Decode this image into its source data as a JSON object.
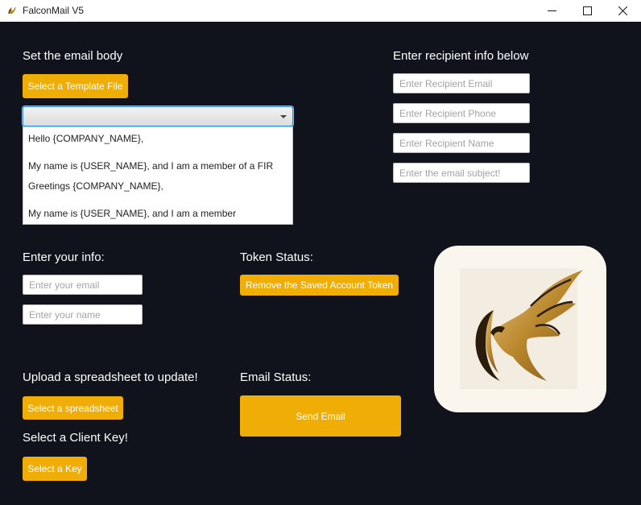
{
  "window": {
    "title": "FalconMail V5",
    "controls": {
      "minimize": "─",
      "maximize": "☐",
      "close": "✕"
    }
  },
  "email_body": {
    "heading": "Set the email body",
    "template_button": "Select a Template File",
    "template_combo_value": "",
    "options": [
      "Hello {COMPANY_NAME},",
      "My name is {USER_NAME}, and I am a member of a FIR",
      "Greetings {COMPANY_NAME},",
      "My name is {USER_NAME}, and I am a member"
    ]
  },
  "recipient": {
    "heading": "Enter recipient info below",
    "email_placeholder": "Enter Recipient Email",
    "phone_placeholder": "Enter Recipient Phone",
    "name_placeholder": "Enter Recipient Name",
    "subject_placeholder": "Enter the email subject!"
  },
  "user_info": {
    "heading": "Enter your info:",
    "email_placeholder": "Enter your email",
    "name_placeholder": "Enter your name"
  },
  "token": {
    "heading": "Token Status:",
    "remove_button": "Remove the Saved Account Token"
  },
  "spreadsheet": {
    "heading": "Upload a spreadsheet to update!",
    "button": "Select a spreadsheet"
  },
  "client_key": {
    "heading": "Select a Client Key!",
    "button": "Select a Key"
  },
  "email_status": {
    "heading": "Email Status:",
    "send_button": "Send Email"
  },
  "colors": {
    "background": "#10131b",
    "accent": "#f0ad06",
    "logo_card": "#faf6ee"
  },
  "icons": {
    "app": "falcon-icon",
    "logo": "falcon-logo-icon"
  }
}
